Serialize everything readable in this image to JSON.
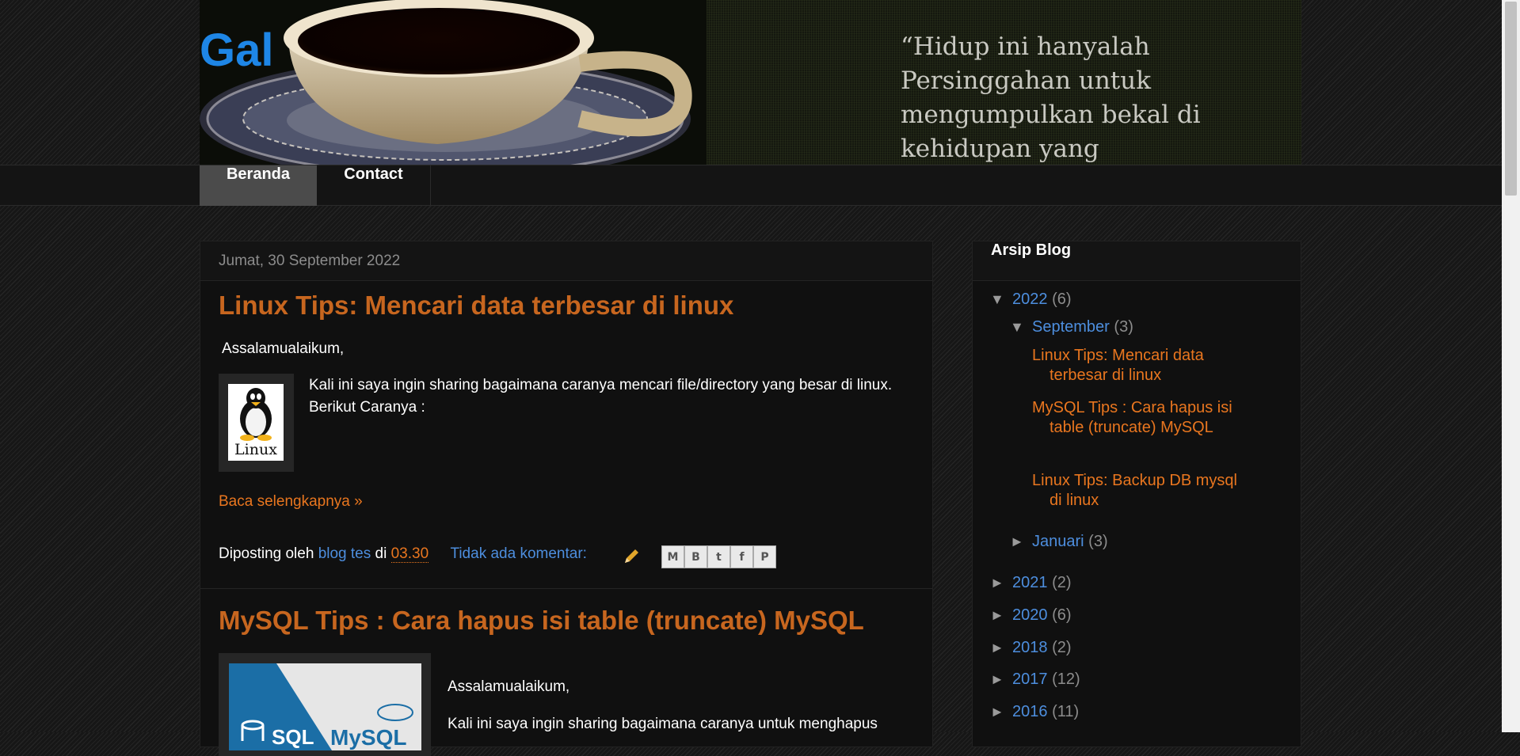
{
  "header": {
    "site_title": "Gal",
    "quote": "“Hidup ini hanyalah Persinggahan untuk mengumpulkan bekal di kehidupan yang sesungguhnya.”"
  },
  "nav": {
    "tabs": [
      {
        "label": "Beranda",
        "active": true
      },
      {
        "label": "Contact",
        "active": false
      }
    ]
  },
  "posts": [
    {
      "date": "Jumat, 30 September 2022",
      "title": "Linux Tips: Mencari data terbesar di linux",
      "greeting": "Assalamualaikum,",
      "body": "Kali ini saya ingin sharing bagaimana caranya mencari file/directory yang besar di linux. Berikut Caranya :",
      "thumb_label": "Linux",
      "read_more": "Baca selengkapnya »",
      "footer": {
        "posted_by": "Diposting oleh",
        "author": "blog tes",
        "at": "di",
        "time": "03.30",
        "comments": "Tidak ada komentar:"
      },
      "share_icons": [
        "email-icon",
        "blogger-icon",
        "twitter-icon",
        "facebook-icon",
        "pinterest-icon"
      ]
    },
    {
      "title": "MySQL Tips : Cara hapus isi table (truncate) MySQL",
      "greeting": "Assalamualaikum,",
      "body": "Kali ini saya ingin sharing bagaimana caranya untuk menghapus",
      "thumb_label_left": "SQL",
      "thumb_label_right": "MySQL"
    }
  ],
  "sidebar": {
    "title": "Arsip Blog",
    "years": [
      {
        "label": "2022",
        "count": "(6)",
        "expanded": true
      },
      {
        "label": "2021",
        "count": "(2)"
      },
      {
        "label": "2020",
        "count": "(6)"
      },
      {
        "label": "2018",
        "count": "(2)"
      },
      {
        "label": "2017",
        "count": "(12)"
      },
      {
        "label": "2016",
        "count": "(11)"
      }
    ],
    "months": [
      {
        "label": "September",
        "count": "(3)",
        "expanded": true
      },
      {
        "label": "Januari",
        "count": "(3)"
      }
    ],
    "september_posts": [
      "Linux Tips: Mencari data terbesar di linux",
      "MySQL Tips : Cara hapus isi table (truncate) MySQL",
      "Linux Tips: Backup DB mysql di linux"
    ],
    "expanded_glyph": "▼",
    "collapsed_glyph": "►"
  },
  "colors": {
    "accent_orange": "#e9761f",
    "title_orange": "#c7661f",
    "link_blue": "#4d8ede",
    "site_title_blue": "#1e86e6"
  }
}
